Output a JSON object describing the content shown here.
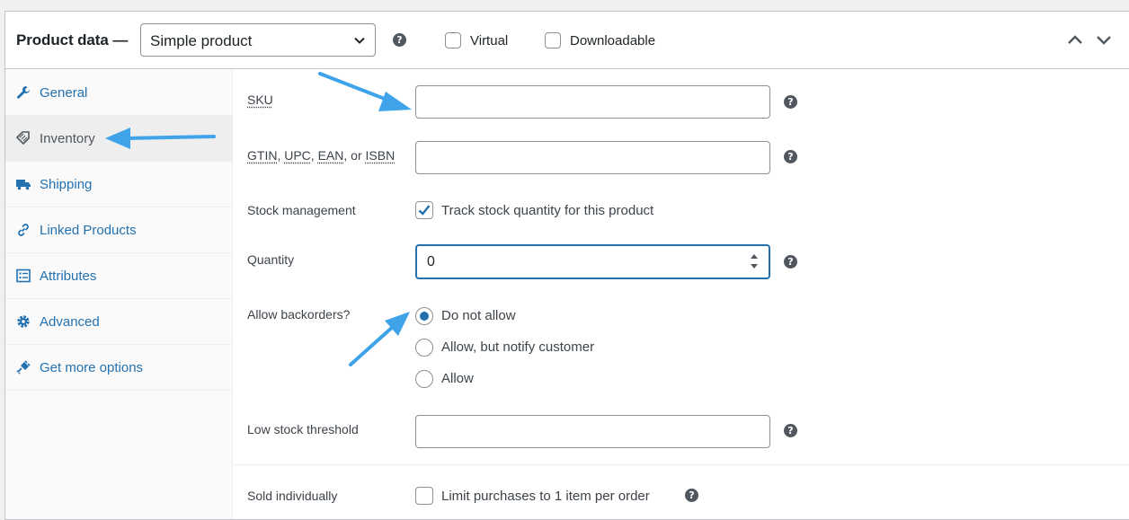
{
  "header": {
    "title": "Product data —",
    "product_type": "Simple product",
    "virtual_label": "Virtual",
    "downloadable_label": "Downloadable",
    "help_glyph": "?"
  },
  "sidebar": {
    "items": [
      {
        "label": "General",
        "icon": "wrench-icon",
        "active": false
      },
      {
        "label": "Inventory",
        "icon": "tag-icon",
        "active": true
      },
      {
        "label": "Shipping",
        "icon": "truck-icon",
        "active": false
      },
      {
        "label": "Linked Products",
        "icon": "link-icon",
        "active": false
      },
      {
        "label": "Attributes",
        "icon": "list-icon",
        "active": false
      },
      {
        "label": "Advanced",
        "icon": "gear-icon",
        "active": false
      },
      {
        "label": "Get more options",
        "icon": "plug-icon",
        "active": false
      }
    ]
  },
  "inventory": {
    "sku_label": "SKU",
    "sku_value": "",
    "gtin_label_parts": [
      "GTIN",
      ", ",
      "UPC",
      ", ",
      "EAN",
      ", or ",
      "ISBN"
    ],
    "gtin_value": "",
    "stock_mgmt_label": "Stock management",
    "stock_mgmt_checkbox_label": "Track stock quantity for this product",
    "stock_mgmt_checked": true,
    "quantity_label": "Quantity",
    "quantity_value": "0",
    "backorders_label": "Allow backorders?",
    "backorder_options": [
      "Do not allow",
      "Allow, but notify customer",
      "Allow"
    ],
    "backorder_selected": "Do not allow",
    "low_stock_label": "Low stock threshold",
    "low_stock_value": "",
    "sold_individually_label": "Sold individually",
    "sold_individually_checkbox_label": "Limit purchases to 1 item per order",
    "sold_individually_checked": false
  },
  "colors": {
    "accent": "#2271b1",
    "annotation_arrow": "#3fa3ea"
  }
}
